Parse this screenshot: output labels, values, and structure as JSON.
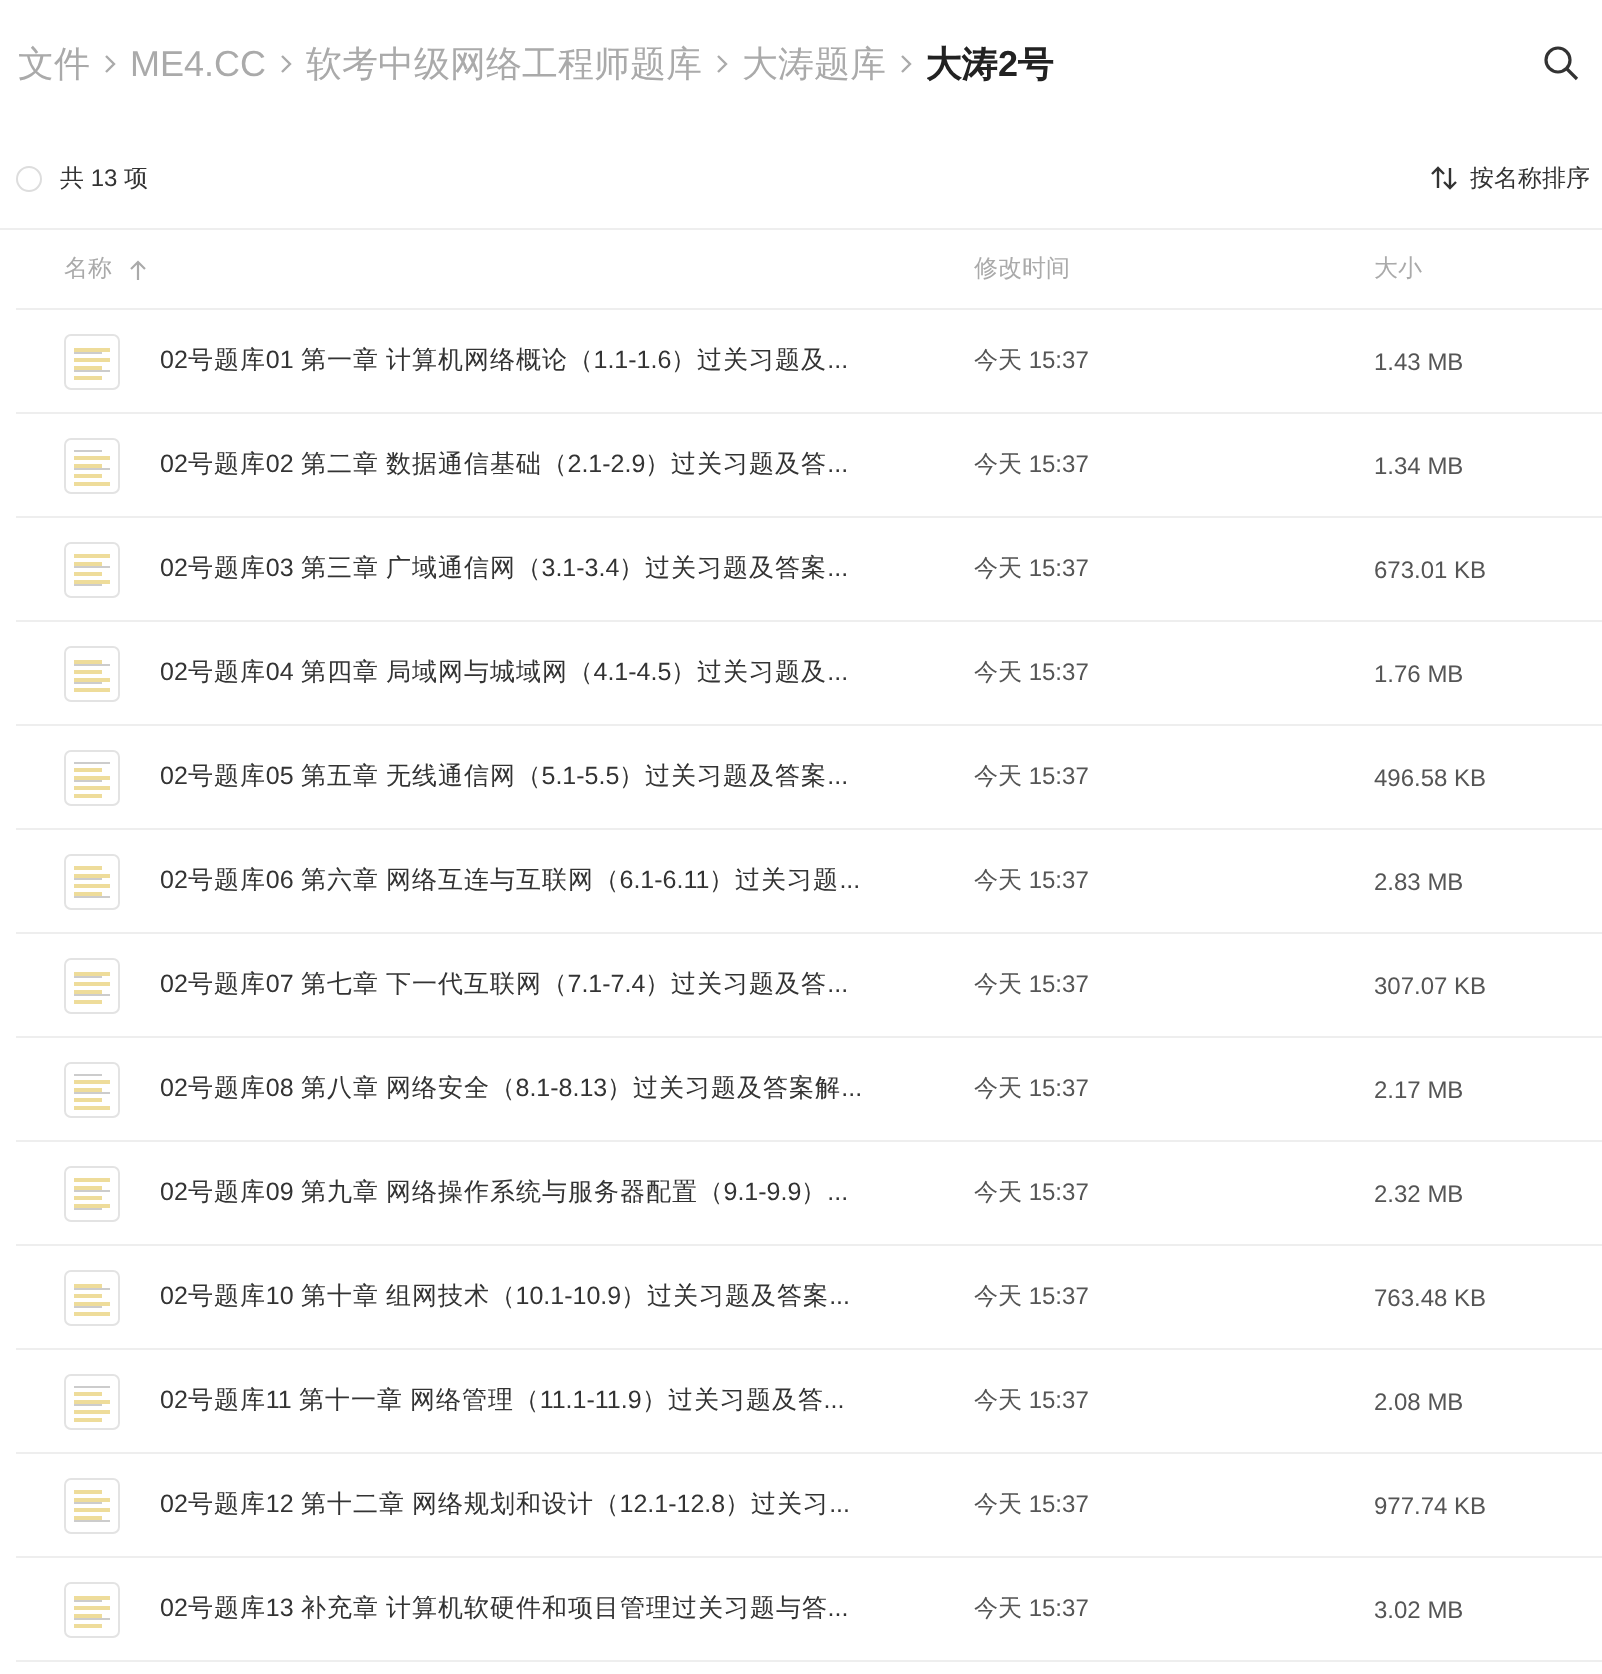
{
  "breadcrumb": [
    {
      "label": "文件",
      "selected": false
    },
    {
      "label": "ME4.CC",
      "selected": false
    },
    {
      "label": "软考中级网络工程师题库",
      "selected": false
    },
    {
      "label": "大涛题库",
      "selected": false
    },
    {
      "label": "大涛2号",
      "selected": true
    }
  ],
  "count": "共 13 项",
  "select_all": {
    "checked": false
  },
  "sort_button": "按名称排序",
  "columns": [
    {
      "label": "名称",
      "sorted": true
    },
    {
      "label": "修改时间",
      "sorted": false
    },
    {
      "label": "大小",
      "sorted": false
    }
  ],
  "rows": [
    {
      "name": "02号题库01 第一章 计算机网络概论（1.1-1.6）过关习题及...",
      "modified": "今天 15:37",
      "size": "1.43 MB"
    },
    {
      "name": "02号题库02 第二章 数据通信基础（2.1-2.9）过关习题及答...",
      "modified": "今天 15:37",
      "size": "1.34 MB"
    },
    {
      "name": "02号题库03 第三章 广域通信网（3.1-3.4）过关习题及答案...",
      "modified": "今天 15:37",
      "size": "673.01 KB"
    },
    {
      "name": "02号题库04 第四章 局域网与城域网（4.1-4.5）过关习题及...",
      "modified": "今天 15:37",
      "size": "1.76 MB"
    },
    {
      "name": "02号题库05 第五章 无线通信网（5.1-5.5）过关习题及答案...",
      "modified": "今天 15:37",
      "size": "496.58 KB"
    },
    {
      "name": "02号题库06 第六章 网络互连与互联网（6.1-6.11）过关习题...",
      "modified": "今天 15:37",
      "size": "2.83 MB"
    },
    {
      "name": "02号题库07 第七章 下一代互联网（7.1-7.4）过关习题及答...",
      "modified": "今天 15:37",
      "size": "307.07 KB"
    },
    {
      "name": "02号题库08 第八章 网络安全（8.1-8.13）过关习题及答案解...",
      "modified": "今天 15:37",
      "size": "2.17 MB"
    },
    {
      "name": "02号题库09 第九章 网络操作系统与服务器配置（9.1-9.9）...",
      "modified": "今天 15:37",
      "size": "2.32 MB"
    },
    {
      "name": "02号题库10 第十章 组网技术（10.1-10.9）过关习题及答案...",
      "modified": "今天 15:37",
      "size": "763.48 KB"
    },
    {
      "name": "02号题库11 第十一章 网络管理（11.1-11.9）过关习题及答...",
      "modified": "今天 15:37",
      "size": "2.08 MB"
    },
    {
      "name": "02号题库12 第十二章 网络规划和设计（12.1-12.8）过关习...",
      "modified": "今天 15:37",
      "size": "977.74 KB"
    },
    {
      "name": "02号题库13 补充章 计算机软硬件和项目管理过关习题与答...",
      "modified": "今天 15:37",
      "size": "3.02 MB"
    }
  ]
}
